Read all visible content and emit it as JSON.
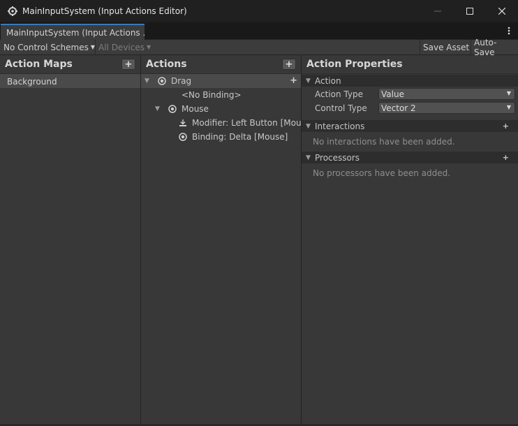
{
  "window": {
    "title": "MainInputSystem (Input Actions Editor)",
    "icon": "unity-gear-icon"
  },
  "tab": {
    "label": "MainInputSystem (Input Actions ..."
  },
  "toolbar": {
    "control_schemes": "No Control Schemes",
    "devices": "All Devices",
    "save_asset": "Save Asset",
    "auto_save": "Auto-Save"
  },
  "action_maps": {
    "title": "Action Maps",
    "items": [
      {
        "label": "Background"
      }
    ]
  },
  "actions": {
    "title": "Actions",
    "tree": [
      {
        "label": "Drag",
        "icon": "action-icon"
      },
      {
        "label": "<No Binding>"
      },
      {
        "label": "Mouse",
        "icon": "action-icon"
      },
      {
        "label": "Modifier: Left Button [Mous",
        "icon": "modifier-icon"
      },
      {
        "label": "Binding: Delta [Mouse]",
        "icon": "binding-icon"
      }
    ]
  },
  "properties": {
    "title": "Action Properties",
    "action_section": "Action",
    "action_type_label": "Action Type",
    "action_type_value": "Value",
    "control_type_label": "Control Type",
    "control_type_value": "Vector 2",
    "interactions_section": "Interactions",
    "interactions_empty": "No interactions have been added.",
    "processors_section": "Processors",
    "processors_empty": "No processors have been added."
  },
  "colors": {
    "accent": "#3a79bb",
    "panel": "#383838",
    "selected": "#4a4a4a"
  }
}
